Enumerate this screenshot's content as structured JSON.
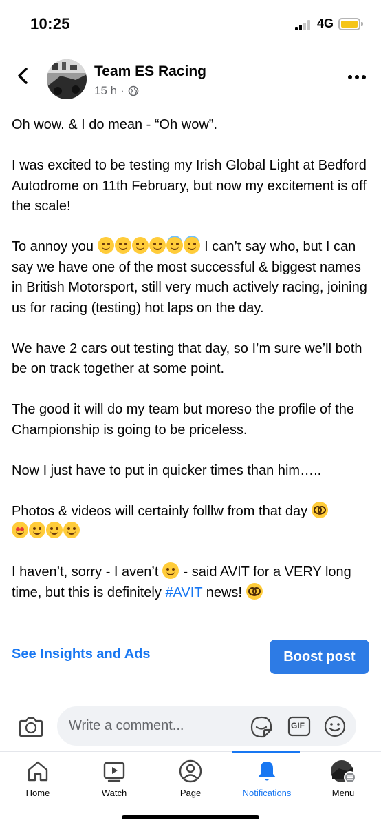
{
  "status_bar": {
    "time": "10:25",
    "network": "4G",
    "battery_color": "#f5c518"
  },
  "post": {
    "page_name": "Team ES Racing",
    "time_ago": "15 h",
    "separator": "·",
    "privacy_icon": "globe-icon",
    "paragraphs": {
      "p1": "Oh wow. & I do mean - “Oh wow”.",
      "p2": "I was excited to be testing my Irish Global Light at Bedford Autodrome on 11th February, but now my excitement is off the scale!",
      "p3_start": "To annoy you ",
      "p3_rest": " I can’t say who, but I can say we have one of the most successful & biggest names in British Motorsport, still very much actively racing, joining us for racing (testing) hot laps on the day.",
      "p4": "We have 2 cars out testing that day, so I’m sure we’ll both be on track together at some point.",
      "p5": "The good it will do my team but moreso the profile of the Championship is going to be priceless.",
      "p6": "Now I just have to put in quicker times than him…..",
      "p7": "Photos & videos will certainly folllw from that day ",
      "p8_start": "I haven’t, sorry - I aven’t ",
      "p8_mid": " - said AVIT for a VERY long time, but this is definitely ",
      "p8_hashtag": "#AVIT",
      "p8_end": " news! "
    }
  },
  "actions": {
    "insights_label": "See Insights and Ads",
    "boost_label": "Boost post",
    "accent_color": "#1877f2"
  },
  "comment_bar": {
    "placeholder": "Write a comment...",
    "gif_label": "GIF"
  },
  "tabs": [
    {
      "label": "Home",
      "icon": "home-icon"
    },
    {
      "label": "Watch",
      "icon": "watch-icon"
    },
    {
      "label": "Page",
      "icon": "page-icon"
    },
    {
      "label": "Notifications",
      "icon": "bell-icon",
      "active": true
    },
    {
      "label": "Menu",
      "icon": "menu-avatar-icon"
    }
  ]
}
